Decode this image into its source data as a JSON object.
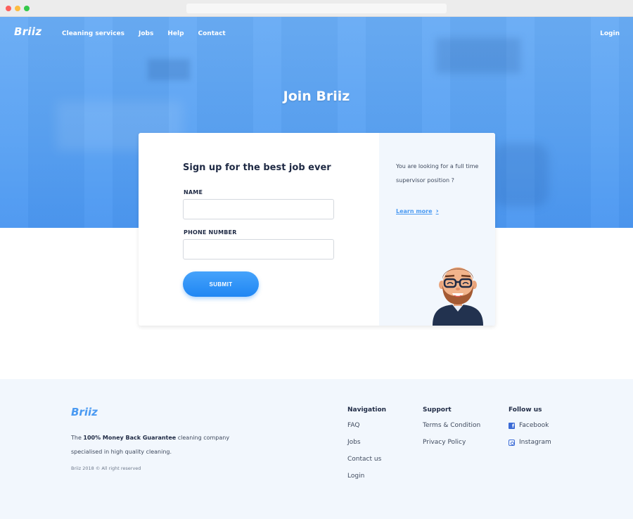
{
  "header": {
    "logo": "Briiz",
    "nav": [
      "Cleaning services",
      "Jobs",
      "Help",
      "Contact"
    ],
    "login": "Login"
  },
  "hero": {
    "title": "Join Briiz"
  },
  "form": {
    "title": "Sign up for the best job ever",
    "name_label": "NAME",
    "name_value": "",
    "phone_label": "PHONE NUMBER",
    "phone_value": "",
    "submit": "SUBMIT"
  },
  "aside": {
    "text": "You are looking for a full time supervisor position ?",
    "link": "Learn more"
  },
  "footer": {
    "logo": "Briiz",
    "tagline_prefix": "The ",
    "tagline_bold": "100% Money Back Guarantee",
    "tagline_suffix": " cleaning company specialised in high quality cleaning.",
    "copyright": "Briiz 2018 © All right reserved",
    "navigation": {
      "title": "Navigation",
      "items": [
        "FAQ",
        "Jobs",
        "Contact us",
        "Login"
      ]
    },
    "support": {
      "title": "Support",
      "items": [
        "Terms & Condition",
        "Privacy Policy"
      ]
    },
    "follow": {
      "title": "Follow us",
      "items": [
        "Facebook",
        "Instagram"
      ]
    }
  },
  "colors": {
    "primary": "#4a9af2",
    "dark": "#1f2a44",
    "footer_bg": "#f2f7fd"
  },
  "icons": [
    "chevron-right-icon",
    "avatar-illustration",
    "facebook-icon",
    "instagram-icon"
  ]
}
